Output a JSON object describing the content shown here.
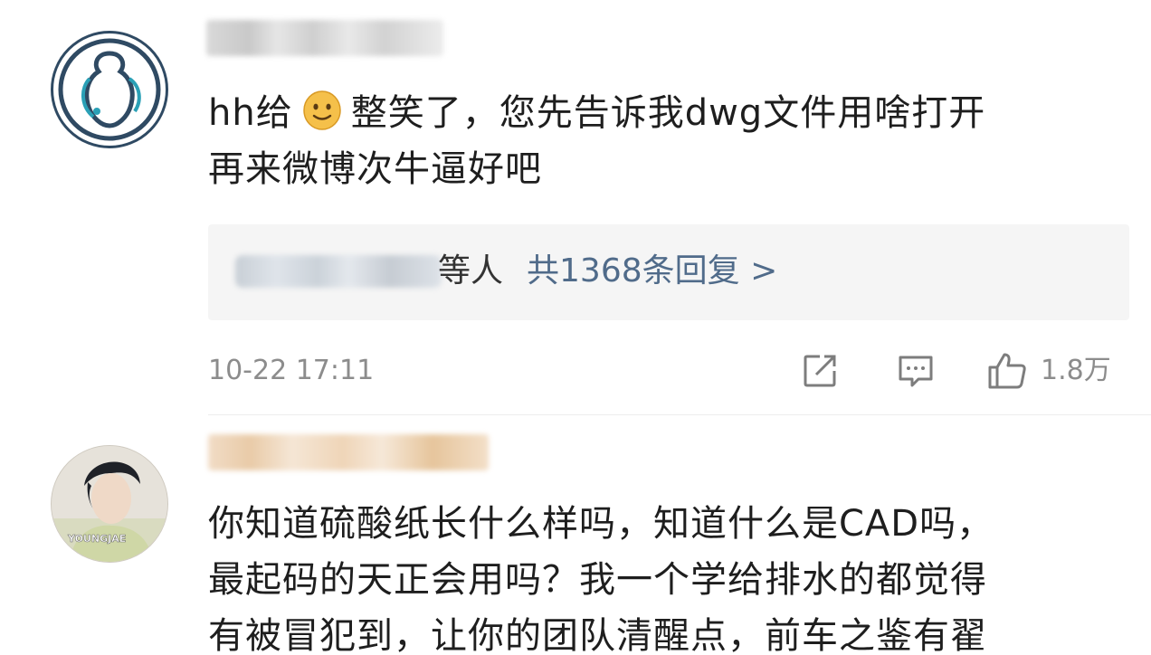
{
  "comments": [
    {
      "avatar_icon": "team-logo-avatar-icon",
      "text_before_emoji": "hh给",
      "emoji_icon": "grinning-face-emoji-icon",
      "text_line1_after_emoji": "整笑了，您先告诉我dwg文件用啥打开",
      "text_line2": "再来微博次牛逼好吧",
      "replies": {
        "suffix": "等人",
        "link": "共1368条回复 >"
      },
      "timestamp": "10-22 17:11",
      "share_icon": "share-icon",
      "comment_icon": "comment-icon",
      "like_icon": "thumbs-up-icon",
      "like_count": "1.8万"
    },
    {
      "avatar_icon": "user-photo-avatar-icon",
      "avatar_text": "YOUNGJAE",
      "text_line1": "你知道硫酸纸长什么样吗，知道什么是CAD吗，",
      "text_line2": "最起码的天正会用吗？我一个学给排水的都觉得",
      "text_line3": "有被冒犯到，让你的团队清醒点，前车之鉴有翟"
    }
  ],
  "colors": {
    "text": "#1e1e1e",
    "meta": "#8c8c8c",
    "link": "#506b8a",
    "reply_bg": "#f5f5f5"
  }
}
